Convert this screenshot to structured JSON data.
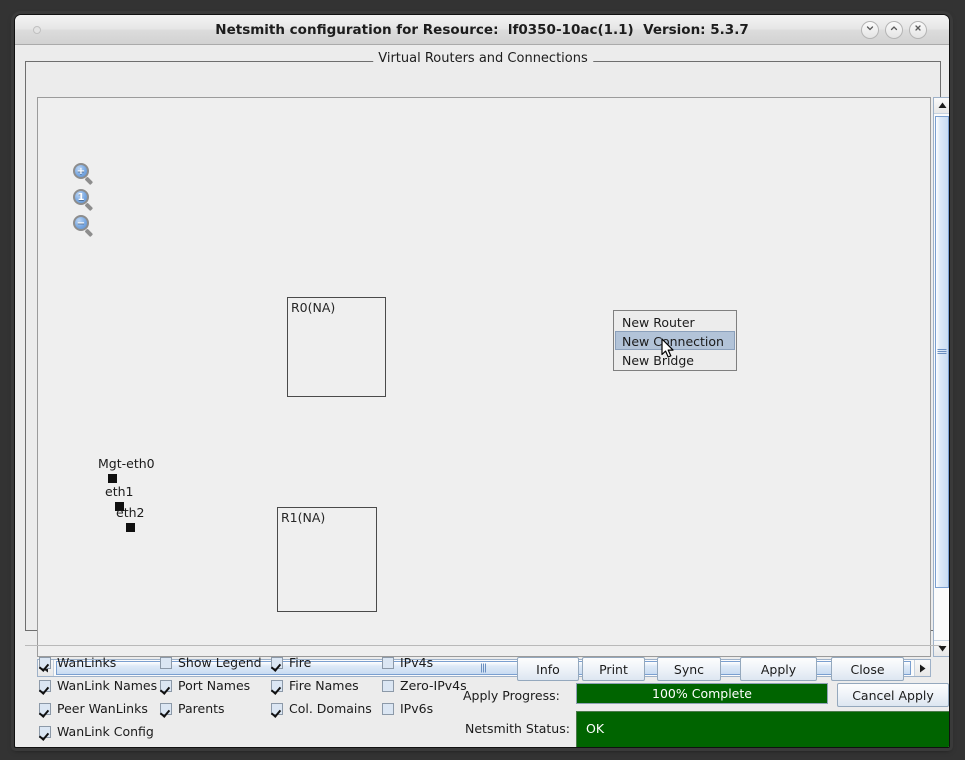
{
  "window": {
    "title": "Netsmith configuration for Resource:  lf0350-10ac(1.1)  Version: 5.3.7",
    "minimize_label": "⌄",
    "maximize_label": "⌃",
    "close_label": "✕"
  },
  "panel": {
    "title": "Virtual Routers and Connections"
  },
  "canvas": {
    "tools": [
      {
        "name": "zoom-in-icon",
        "glyph": "+"
      },
      {
        "name": "zoom-actual-icon",
        "glyph": "1"
      },
      {
        "name": "zoom-out-icon",
        "glyph": "−"
      }
    ],
    "routers": [
      {
        "label": "R0(NA)"
      },
      {
        "label": "R1(NA)"
      }
    ],
    "ports": [
      {
        "label": "Mgt-eth0"
      },
      {
        "label": "eth1"
      },
      {
        "label": "eth2"
      }
    ],
    "context_menu": {
      "items": [
        {
          "label": "New Router",
          "selected": false
        },
        {
          "label": "New Connection",
          "selected": true
        },
        {
          "label": "New Bridge",
          "selected": false
        }
      ]
    }
  },
  "options": {
    "checkboxes": [
      {
        "label": "WanLinks",
        "checked": true,
        "col": 0,
        "row": 0
      },
      {
        "label": "WanLink Names",
        "checked": true,
        "col": 0,
        "row": 1
      },
      {
        "label": "Peer WanLinks",
        "checked": true,
        "col": 0,
        "row": 2
      },
      {
        "label": "WanLink Config",
        "checked": true,
        "col": 0,
        "row": 3
      },
      {
        "label": "Show Legend",
        "checked": false,
        "col": 1,
        "row": 0
      },
      {
        "label": "Port Names",
        "checked": true,
        "col": 1,
        "row": 1
      },
      {
        "label": "Parents",
        "checked": true,
        "col": 1,
        "row": 2
      },
      {
        "label": "Fire",
        "checked": true,
        "col": 2,
        "row": 0
      },
      {
        "label": "Fire Names",
        "checked": true,
        "col": 2,
        "row": 1
      },
      {
        "label": "Col. Domains",
        "checked": true,
        "col": 2,
        "row": 2
      },
      {
        "label": "IPv4s",
        "checked": false,
        "col": 3,
        "row": 0
      },
      {
        "label": "Zero-IPv4s",
        "checked": false,
        "col": 3,
        "row": 1
      },
      {
        "label": "IPv6s",
        "checked": false,
        "col": 3,
        "row": 2
      }
    ]
  },
  "buttons": {
    "info": "Info",
    "print": "Print",
    "sync": "Sync",
    "apply": "Apply",
    "close": "Close",
    "cancel_apply": "Cancel Apply"
  },
  "progress": {
    "label": "Apply Progress:",
    "text": "100% Complete",
    "percent": 100,
    "fill_color": "#006400"
  },
  "status": {
    "label": "Netsmith Status:",
    "value": "OK",
    "background_color": "#006400"
  },
  "scrollbars": {
    "vertical": {
      "up": "▲",
      "down": "▼"
    },
    "horizontal": {
      "left": "◀",
      "right": "▶"
    }
  }
}
